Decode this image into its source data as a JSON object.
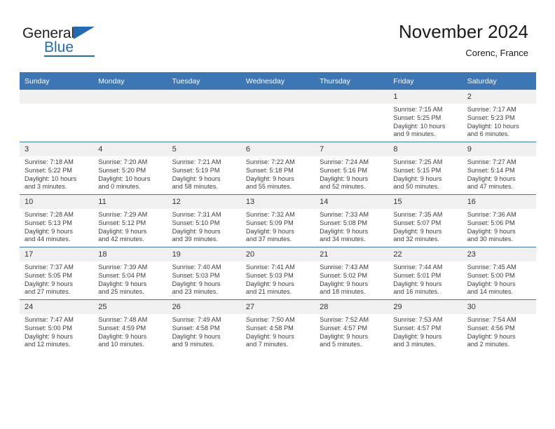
{
  "brand": {
    "name_part1": "General",
    "name_part2": "Blue",
    "triangle_color": "#1f6cb4"
  },
  "header": {
    "title": "November 2024",
    "subtitle": "Corenc, France"
  },
  "theme": {
    "accent": "#3c76b5",
    "daynum_bg": "#f0f0f0",
    "text": "#3d3d3d"
  },
  "weekdays": [
    "Sunday",
    "Monday",
    "Tuesday",
    "Wednesday",
    "Thursday",
    "Friday",
    "Saturday"
  ],
  "weeks": [
    [
      {
        "day": "",
        "sunrise": "",
        "sunset": "",
        "daylight_line1": "",
        "daylight_line2": ""
      },
      {
        "day": "",
        "sunrise": "",
        "sunset": "",
        "daylight_line1": "",
        "daylight_line2": ""
      },
      {
        "day": "",
        "sunrise": "",
        "sunset": "",
        "daylight_line1": "",
        "daylight_line2": ""
      },
      {
        "day": "",
        "sunrise": "",
        "sunset": "",
        "daylight_line1": "",
        "daylight_line2": ""
      },
      {
        "day": "",
        "sunrise": "",
        "sunset": "",
        "daylight_line1": "",
        "daylight_line2": ""
      },
      {
        "day": "1",
        "sunrise": "Sunrise: 7:15 AM",
        "sunset": "Sunset: 5:25 PM",
        "daylight_line1": "Daylight: 10 hours",
        "daylight_line2": "and 9 minutes."
      },
      {
        "day": "2",
        "sunrise": "Sunrise: 7:17 AM",
        "sunset": "Sunset: 5:23 PM",
        "daylight_line1": "Daylight: 10 hours",
        "daylight_line2": "and 6 minutes."
      }
    ],
    [
      {
        "day": "3",
        "sunrise": "Sunrise: 7:18 AM",
        "sunset": "Sunset: 5:22 PM",
        "daylight_line1": "Daylight: 10 hours",
        "daylight_line2": "and 3 minutes."
      },
      {
        "day": "4",
        "sunrise": "Sunrise: 7:20 AM",
        "sunset": "Sunset: 5:20 PM",
        "daylight_line1": "Daylight: 10 hours",
        "daylight_line2": "and 0 minutes."
      },
      {
        "day": "5",
        "sunrise": "Sunrise: 7:21 AM",
        "sunset": "Sunset: 5:19 PM",
        "daylight_line1": "Daylight: 9 hours",
        "daylight_line2": "and 58 minutes."
      },
      {
        "day": "6",
        "sunrise": "Sunrise: 7:22 AM",
        "sunset": "Sunset: 5:18 PM",
        "daylight_line1": "Daylight: 9 hours",
        "daylight_line2": "and 55 minutes."
      },
      {
        "day": "7",
        "sunrise": "Sunrise: 7:24 AM",
        "sunset": "Sunset: 5:16 PM",
        "daylight_line1": "Daylight: 9 hours",
        "daylight_line2": "and 52 minutes."
      },
      {
        "day": "8",
        "sunrise": "Sunrise: 7:25 AM",
        "sunset": "Sunset: 5:15 PM",
        "daylight_line1": "Daylight: 9 hours",
        "daylight_line2": "and 50 minutes."
      },
      {
        "day": "9",
        "sunrise": "Sunrise: 7:27 AM",
        "sunset": "Sunset: 5:14 PM",
        "daylight_line1": "Daylight: 9 hours",
        "daylight_line2": "and 47 minutes."
      }
    ],
    [
      {
        "day": "10",
        "sunrise": "Sunrise: 7:28 AM",
        "sunset": "Sunset: 5:13 PM",
        "daylight_line1": "Daylight: 9 hours",
        "daylight_line2": "and 44 minutes."
      },
      {
        "day": "11",
        "sunrise": "Sunrise: 7:29 AM",
        "sunset": "Sunset: 5:12 PM",
        "daylight_line1": "Daylight: 9 hours",
        "daylight_line2": "and 42 minutes."
      },
      {
        "day": "12",
        "sunrise": "Sunrise: 7:31 AM",
        "sunset": "Sunset: 5:10 PM",
        "daylight_line1": "Daylight: 9 hours",
        "daylight_line2": "and 39 minutes."
      },
      {
        "day": "13",
        "sunrise": "Sunrise: 7:32 AM",
        "sunset": "Sunset: 5:09 PM",
        "daylight_line1": "Daylight: 9 hours",
        "daylight_line2": "and 37 minutes."
      },
      {
        "day": "14",
        "sunrise": "Sunrise: 7:33 AM",
        "sunset": "Sunset: 5:08 PM",
        "daylight_line1": "Daylight: 9 hours",
        "daylight_line2": "and 34 minutes."
      },
      {
        "day": "15",
        "sunrise": "Sunrise: 7:35 AM",
        "sunset": "Sunset: 5:07 PM",
        "daylight_line1": "Daylight: 9 hours",
        "daylight_line2": "and 32 minutes."
      },
      {
        "day": "16",
        "sunrise": "Sunrise: 7:36 AM",
        "sunset": "Sunset: 5:06 PM",
        "daylight_line1": "Daylight: 9 hours",
        "daylight_line2": "and 30 minutes."
      }
    ],
    [
      {
        "day": "17",
        "sunrise": "Sunrise: 7:37 AM",
        "sunset": "Sunset: 5:05 PM",
        "daylight_line1": "Daylight: 9 hours",
        "daylight_line2": "and 27 minutes."
      },
      {
        "day": "18",
        "sunrise": "Sunrise: 7:39 AM",
        "sunset": "Sunset: 5:04 PM",
        "daylight_line1": "Daylight: 9 hours",
        "daylight_line2": "and 25 minutes."
      },
      {
        "day": "19",
        "sunrise": "Sunrise: 7:40 AM",
        "sunset": "Sunset: 5:03 PM",
        "daylight_line1": "Daylight: 9 hours",
        "daylight_line2": "and 23 minutes."
      },
      {
        "day": "20",
        "sunrise": "Sunrise: 7:41 AM",
        "sunset": "Sunset: 5:03 PM",
        "daylight_line1": "Daylight: 9 hours",
        "daylight_line2": "and 21 minutes."
      },
      {
        "day": "21",
        "sunrise": "Sunrise: 7:43 AM",
        "sunset": "Sunset: 5:02 PM",
        "daylight_line1": "Daylight: 9 hours",
        "daylight_line2": "and 18 minutes."
      },
      {
        "day": "22",
        "sunrise": "Sunrise: 7:44 AM",
        "sunset": "Sunset: 5:01 PM",
        "daylight_line1": "Daylight: 9 hours",
        "daylight_line2": "and 16 minutes."
      },
      {
        "day": "23",
        "sunrise": "Sunrise: 7:45 AM",
        "sunset": "Sunset: 5:00 PM",
        "daylight_line1": "Daylight: 9 hours",
        "daylight_line2": "and 14 minutes."
      }
    ],
    [
      {
        "day": "24",
        "sunrise": "Sunrise: 7:47 AM",
        "sunset": "Sunset: 5:00 PM",
        "daylight_line1": "Daylight: 9 hours",
        "daylight_line2": "and 12 minutes."
      },
      {
        "day": "25",
        "sunrise": "Sunrise: 7:48 AM",
        "sunset": "Sunset: 4:59 PM",
        "daylight_line1": "Daylight: 9 hours",
        "daylight_line2": "and 10 minutes."
      },
      {
        "day": "26",
        "sunrise": "Sunrise: 7:49 AM",
        "sunset": "Sunset: 4:58 PM",
        "daylight_line1": "Daylight: 9 hours",
        "daylight_line2": "and 9 minutes."
      },
      {
        "day": "27",
        "sunrise": "Sunrise: 7:50 AM",
        "sunset": "Sunset: 4:58 PM",
        "daylight_line1": "Daylight: 9 hours",
        "daylight_line2": "and 7 minutes."
      },
      {
        "day": "28",
        "sunrise": "Sunrise: 7:52 AM",
        "sunset": "Sunset: 4:57 PM",
        "daylight_line1": "Daylight: 9 hours",
        "daylight_line2": "and 5 minutes."
      },
      {
        "day": "29",
        "sunrise": "Sunrise: 7:53 AM",
        "sunset": "Sunset: 4:57 PM",
        "daylight_line1": "Daylight: 9 hours",
        "daylight_line2": "and 3 minutes."
      },
      {
        "day": "30",
        "sunrise": "Sunrise: 7:54 AM",
        "sunset": "Sunset: 4:56 PM",
        "daylight_line1": "Daylight: 9 hours",
        "daylight_line2": "and 2 minutes."
      }
    ]
  ]
}
